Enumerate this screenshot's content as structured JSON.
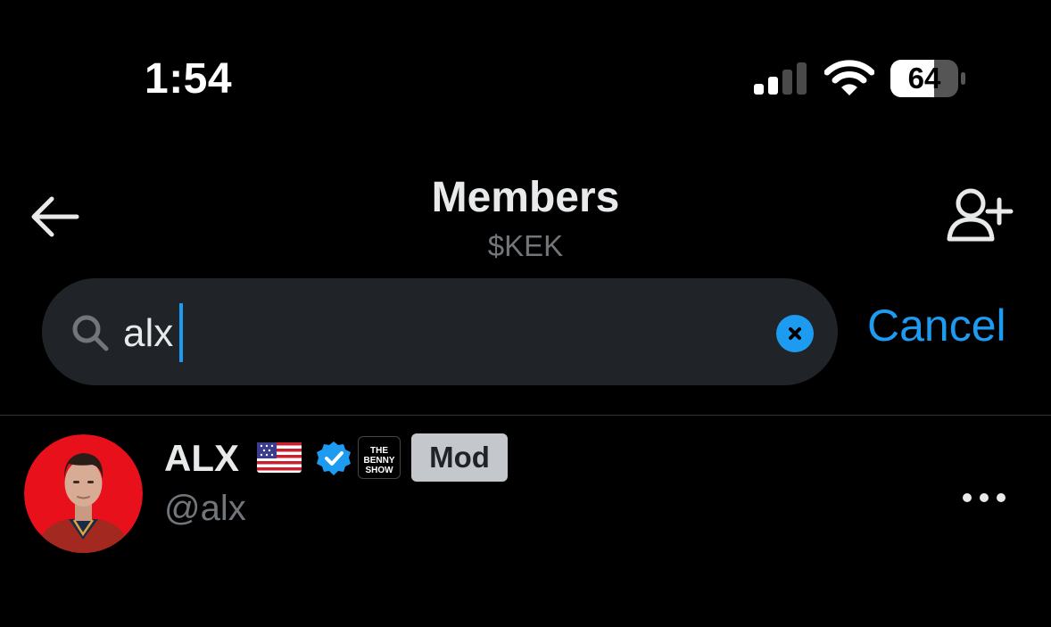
{
  "status_bar": {
    "time": "1:54",
    "battery": "64",
    "icons": [
      "cellular-signal-icon",
      "wifi-icon",
      "battery-icon"
    ]
  },
  "header": {
    "title": "Members",
    "subtitle": "$KEK",
    "back_icon": "arrow-left-icon",
    "add_icon": "add-person-icon"
  },
  "search": {
    "value": "alx",
    "placeholder": "",
    "cancel_label": "Cancel",
    "search_icon": "search-icon",
    "clear_icon": "clear-x-icon"
  },
  "members": [
    {
      "name": "ALX",
      "handle": "@alx",
      "badge": "Mod",
      "flag_icon": "us-flag-icon",
      "verified_icon": "verified-badge-icon",
      "affiliate_text": "THE BENNY SHOW",
      "more_icon": "more-dots-icon"
    }
  ],
  "colors": {
    "background": "#000000",
    "accent": "#1d9bf0",
    "search_bg": "#202327",
    "secondary_text": "#71767b",
    "badge_bg": "#c4c7cb",
    "avatar_bg": "#e8101b"
  }
}
